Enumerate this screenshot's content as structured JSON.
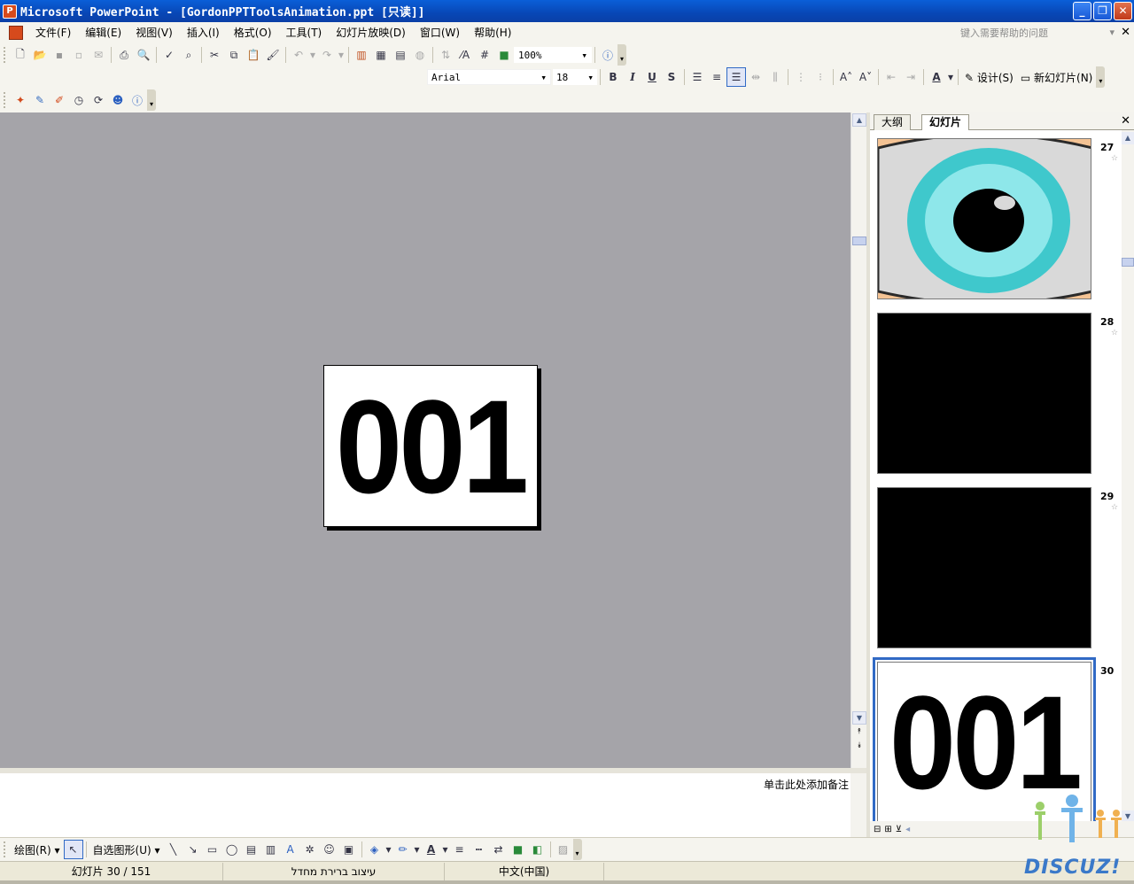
{
  "window": {
    "title": "Microsoft PowerPoint - [GordonPPTToolsAnimation.ppt [只读]]",
    "app_icon_glyph": "P"
  },
  "menu": {
    "items": [
      "文件(F)",
      "编辑(E)",
      "视图(V)",
      "插入(I)",
      "格式(O)",
      "工具(T)",
      "幻灯片放映(D)",
      "窗口(W)",
      "帮助(H)"
    ],
    "help_placeholder": "键入需要帮助的问题"
  },
  "toolbar": {
    "zoom": "100%",
    "font_name": "Arial",
    "font_size": "18",
    "bold": "B",
    "italic": "I",
    "underline": "U",
    "shadow": "S",
    "design_label": "设计(S)",
    "new_slide_label": "新幻灯片(N)"
  },
  "slide": {
    "content": "001"
  },
  "right_panel": {
    "tabs": [
      "大纲",
      "幻灯片"
    ],
    "thumbnails": [
      {
        "number": "27",
        "kind": "eye"
      },
      {
        "number": "28",
        "kind": "black"
      },
      {
        "number": "29",
        "kind": "black"
      },
      {
        "number": "30",
        "kind": "text",
        "text": "001",
        "selected": true
      }
    ]
  },
  "notes": {
    "placeholder": "单击此处添加备注"
  },
  "drawbar": {
    "draw_label": "绘图(R)",
    "autoshapes_label": "自选图形(U)"
  },
  "status": {
    "slide_position": "幻灯片 30 / 151",
    "template": "עיצוב ברירת מחדל",
    "language": "中文(中国)"
  },
  "watermark": {
    "text": "DISCUZ!"
  },
  "colors": {
    "titlebar": "#0a5fd8",
    "workspace": "#a5a4a9",
    "selection": "#316ac5"
  }
}
